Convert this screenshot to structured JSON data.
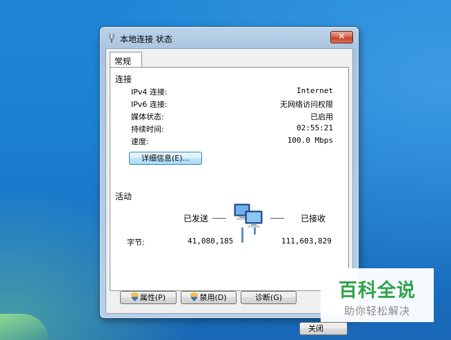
{
  "window": {
    "title": "本地连接 状态",
    "close_symbol": "✕",
    "close_label": "关闭"
  },
  "tab": {
    "label": "常规"
  },
  "connection": {
    "group_label": "连接",
    "rows": [
      {
        "label": "IPv4 连接:",
        "value": "Internet"
      },
      {
        "label": "IPv6 连接:",
        "value": "无网络访问权限"
      },
      {
        "label": "媒体状态:",
        "value": "已启用"
      },
      {
        "label": "持续时间:",
        "value": "02:55:21"
      },
      {
        "label": "速度:",
        "value": "100.0 Mbps"
      }
    ],
    "details_button": "详细信息(E)..."
  },
  "activity": {
    "group_label": "活动",
    "sent_label": "已发送",
    "received_label": "已接收",
    "bytes_label": "字节:",
    "bytes_sent": "41,080,185",
    "bytes_received": "111,603,829"
  },
  "buttons": {
    "properties": "属性(P)",
    "disable": "禁用(D)",
    "diagnose": "诊断(G)"
  },
  "watermark": {
    "title": "百科全说",
    "subtitle": "助你轻松解决"
  },
  "colors": {
    "desktop": "#1b7fd1",
    "close_button": "#c8412a",
    "watermark_green": "#2fa34b"
  },
  "icons": [
    "network-connection-icon",
    "shield-icon",
    "network-computers-icon",
    "close-icon"
  ]
}
